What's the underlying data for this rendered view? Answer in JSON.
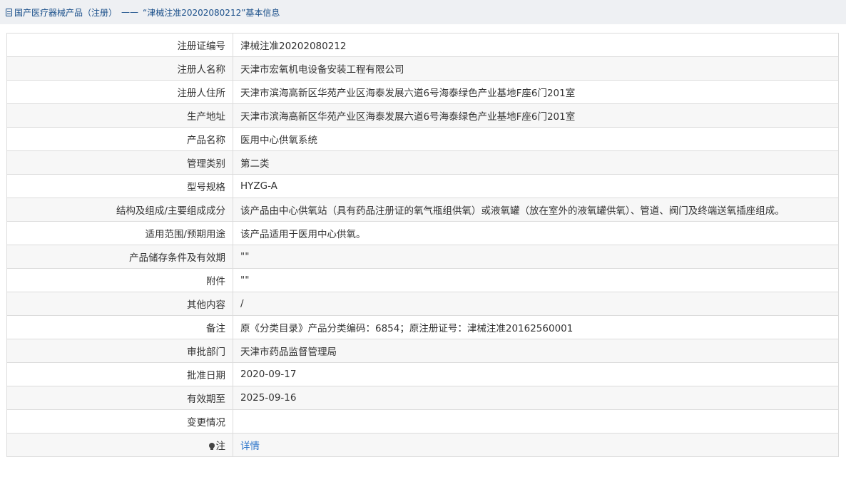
{
  "breadcrumb": {
    "section": "国产医疗器械产品（注册）",
    "separator": "——",
    "record_title": "“津械注准20202080212”基本信息"
  },
  "rows": [
    {
      "label": "注册证编号",
      "value": "津械注准20202080212"
    },
    {
      "label": "注册人名称",
      "value": "天津市宏氧机电设备安装工程有限公司"
    },
    {
      "label": "注册人住所",
      "value": "天津市滨海高新区华苑产业区海泰发展六道6号海泰绿色产业基地F座6门201室"
    },
    {
      "label": "生产地址",
      "value": "天津市滨海高新区华苑产业区海泰发展六道6号海泰绿色产业基地F座6门201室"
    },
    {
      "label": "产品名称",
      "value": "医用中心供氧系统"
    },
    {
      "label": "管理类别",
      "value": "第二类"
    },
    {
      "label": "型号规格",
      "value": "HYZG-A"
    },
    {
      "label": "结构及组成/主要组成成分",
      "value": "该产品由中心供氧站（具有药品注册证的氧气瓶组供氧）或液氧罐（放在室外的液氧罐供氧）、管道、阀门及终端送氧插座组成。"
    },
    {
      "label": "适用范围/预期用途",
      "value": "该产品适用于医用中心供氧。"
    },
    {
      "label": "产品储存条件及有效期",
      "value": "\"\""
    },
    {
      "label": "附件",
      "value": "\"\""
    },
    {
      "label": "其他内容",
      "value": "/"
    },
    {
      "label": "备注",
      "value": "原《分类目录》产品分类编码：6854；原注册证号：津械注准20162560001"
    },
    {
      "label": "审批部门",
      "value": "天津市药品监督管理局"
    },
    {
      "label": "批准日期",
      "value": "2020-09-17"
    },
    {
      "label": "有效期至",
      "value": "2025-09-16"
    },
    {
      "label": "变更情况",
      "value": ""
    }
  ],
  "note_row": {
    "icon": "lightbulb-icon",
    "label": "注",
    "link_text": "详情"
  }
}
